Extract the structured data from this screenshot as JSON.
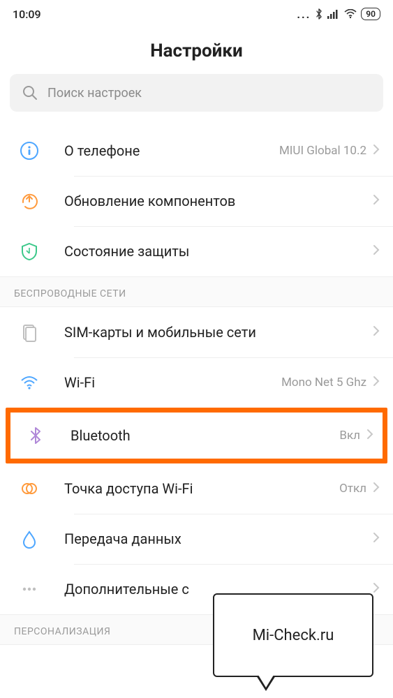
{
  "status": {
    "time": "10:09",
    "battery": "90"
  },
  "header": {
    "title": "Настройки"
  },
  "search": {
    "placeholder": "Поиск настроек"
  },
  "sections": {
    "main": [
      {
        "label": "О телефоне",
        "value": "MIUI Global 10.2"
      },
      {
        "label": "Обновление компонентов",
        "value": ""
      },
      {
        "label": "Состояние защиты",
        "value": ""
      }
    ],
    "wireless_header": "БЕСПРОВОДНЫЕ СЕТИ",
    "wireless": [
      {
        "label": "SIM-карты и мобильные сети",
        "value": ""
      },
      {
        "label": "Wi-Fi",
        "value": "Mono Net 5 Ghz"
      },
      {
        "label": "Bluetooth",
        "value": "Вкл"
      },
      {
        "label": "Точка доступа Wi-Fi",
        "value": "Откл"
      },
      {
        "label": "Передача данных",
        "value": ""
      },
      {
        "label": "Дополнительные с",
        "value": ""
      }
    ],
    "personalization_header": "ПЕРСОНАЛИЗАЦИЯ"
  },
  "callout": {
    "text": "Mi-Check.ru"
  },
  "colors": {
    "highlight": "#ff6a00",
    "icon_blue": "#4da6ff",
    "icon_orange": "#ff9a3c",
    "icon_green": "#3cc88a",
    "icon_gray": "#bfbfbf",
    "icon_purple": "#b088d8"
  }
}
